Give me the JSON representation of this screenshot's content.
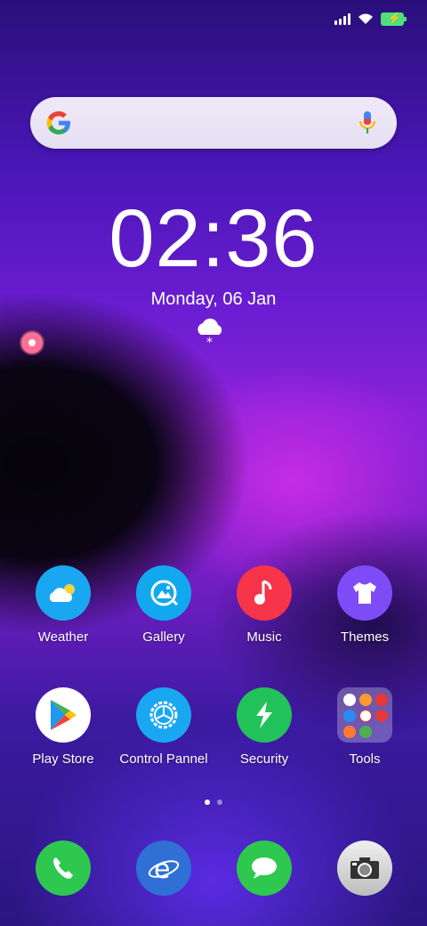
{
  "status_bar": {
    "icons": [
      "signal-icon",
      "wifi-icon",
      "battery-charging-icon"
    ]
  },
  "search_bar": {
    "icons": [
      "google-logo-icon",
      "microphone-icon"
    ]
  },
  "clock": {
    "time": "02:36",
    "date": "Monday, 06 Jan",
    "weather_icon": "snow-cloud-icon"
  },
  "apps_row1": [
    {
      "label": "Weather",
      "icon": "weather-icon",
      "color": "#1aa7f2"
    },
    {
      "label": "Gallery",
      "icon": "gallery-icon",
      "color": "#12a8f0"
    },
    {
      "label": "Music",
      "icon": "music-icon",
      "color": "#f6344a"
    },
    {
      "label": "Themes",
      "icon": "themes-icon",
      "color": "#7d4cf7"
    }
  ],
  "apps_row2": [
    {
      "label": "Play Store",
      "icon": "play-store-icon",
      "color": "#ffffff"
    },
    {
      "label": "Control Pannel",
      "icon": "control-panel-icon",
      "color": "#1aa7f2"
    },
    {
      "label": "Security",
      "icon": "security-icon",
      "color": "#22c25a"
    },
    {
      "label": "Tools",
      "icon": "tools-folder-icon",
      "color": "#ffffff"
    }
  ],
  "pager": {
    "pages": 2,
    "active": 1
  },
  "dock": [
    {
      "icon": "phone-icon",
      "color": "#2ec84f"
    },
    {
      "icon": "browser-icon",
      "color": "#2f6fd6"
    },
    {
      "icon": "messages-icon",
      "color": "#2ec84f"
    },
    {
      "icon": "camera-icon",
      "color": "#d9d9d9"
    }
  ]
}
